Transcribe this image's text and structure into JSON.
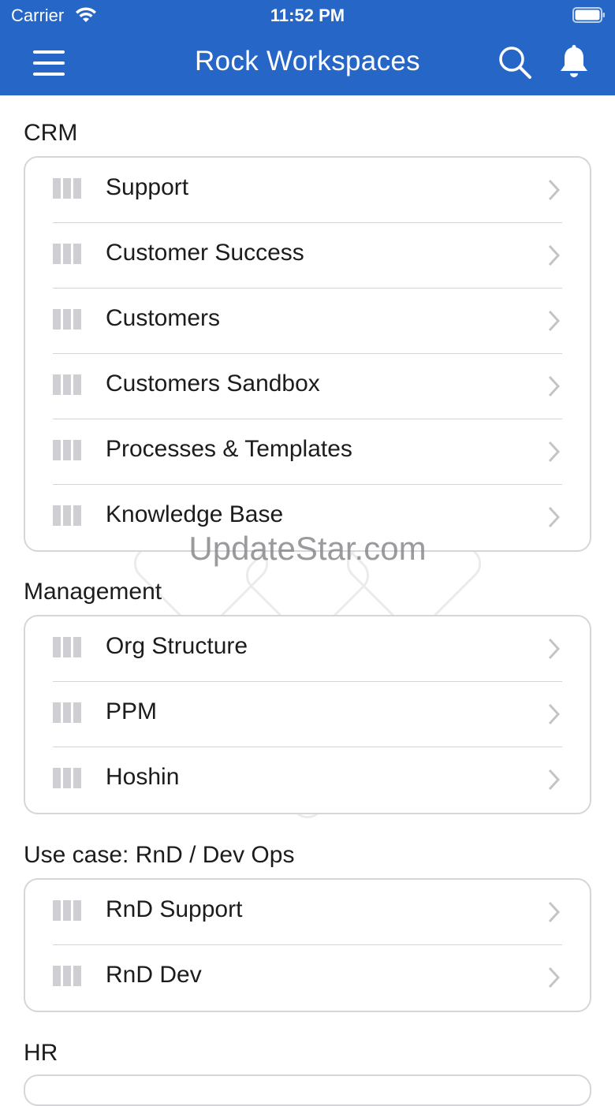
{
  "status_bar": {
    "carrier": "Carrier",
    "time": "11:52 PM"
  },
  "navbar": {
    "title": "Rock Workspaces"
  },
  "sections": [
    {
      "title": "CRM",
      "items": [
        {
          "label": "Support"
        },
        {
          "label": "Customer Success"
        },
        {
          "label": "Customers"
        },
        {
          "label": "Customers Sandbox"
        },
        {
          "label": "Processes & Templates"
        },
        {
          "label": "Knowledge Base"
        }
      ]
    },
    {
      "title": "Management",
      "items": [
        {
          "label": "Org Structure"
        },
        {
          "label": "PPM"
        },
        {
          "label": "Hoshin"
        }
      ]
    },
    {
      "title": "Use case: RnD / Dev Ops",
      "items": [
        {
          "label": "RnD Support"
        },
        {
          "label": "RnD Dev"
        }
      ]
    },
    {
      "title": "HR",
      "items": []
    }
  ],
  "watermark": "UpdateStar.com",
  "colors": {
    "accent": "#2566c6",
    "divider": "#d4d4d8",
    "icon": "#cfcfd3"
  },
  "icons": {
    "menu": "hamburger-icon",
    "search": "search-icon",
    "bell": "bell-icon",
    "workspace": "workspace-icon",
    "chevron": "chevron-right-icon"
  }
}
